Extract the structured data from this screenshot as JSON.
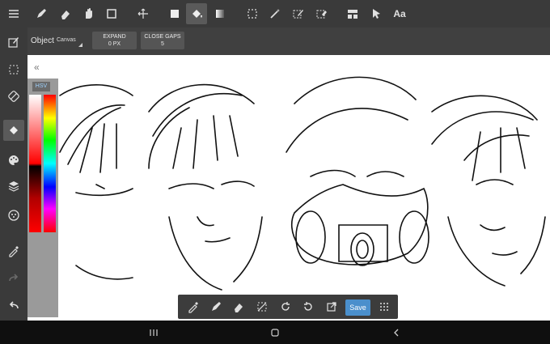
{
  "top_toolbar": {
    "tools": [
      "menu-icon",
      "pen-icon",
      "eraser-icon",
      "hand-icon",
      "select-rect-icon",
      "transform-icon",
      "fill-square-icon",
      "bucket-icon",
      "gradient-icon",
      "marquee-icon",
      "magic-wand-icon",
      "select-pen-icon",
      "select-eraser-icon",
      "layer-split-icon",
      "cursor-icon",
      "text-icon"
    ],
    "text_tool_label": "Aa"
  },
  "options_bar": {
    "object_label": "Object",
    "object_value": "Canvas",
    "expand_label": "EXPAND",
    "expand_value": "0 PX",
    "close_gaps_label": "CLOSE GAPS",
    "close_gaps_value": "5"
  },
  "left_toolbar": {
    "tools": [
      "edit-icon",
      "select-icon",
      "rotate-icon",
      "bucket-icon",
      "palette-icon",
      "layers-icon",
      "material-icon",
      "eyedropper-icon",
      "redo-icon",
      "undo-icon"
    ]
  },
  "color_panel": {
    "tab_label": "HSV",
    "collapse_glyph": "«"
  },
  "bottom_toolbar": {
    "tools": [
      "eyedropper-icon",
      "pen-icon",
      "eraser-icon",
      "deselect-icon",
      "undo-icon",
      "redo-icon",
      "open-icon",
      "grid-icon"
    ],
    "save_label": "Save"
  },
  "colors": {
    "accent": "#4a8fcc",
    "toolbar": "#3a3a3a"
  }
}
